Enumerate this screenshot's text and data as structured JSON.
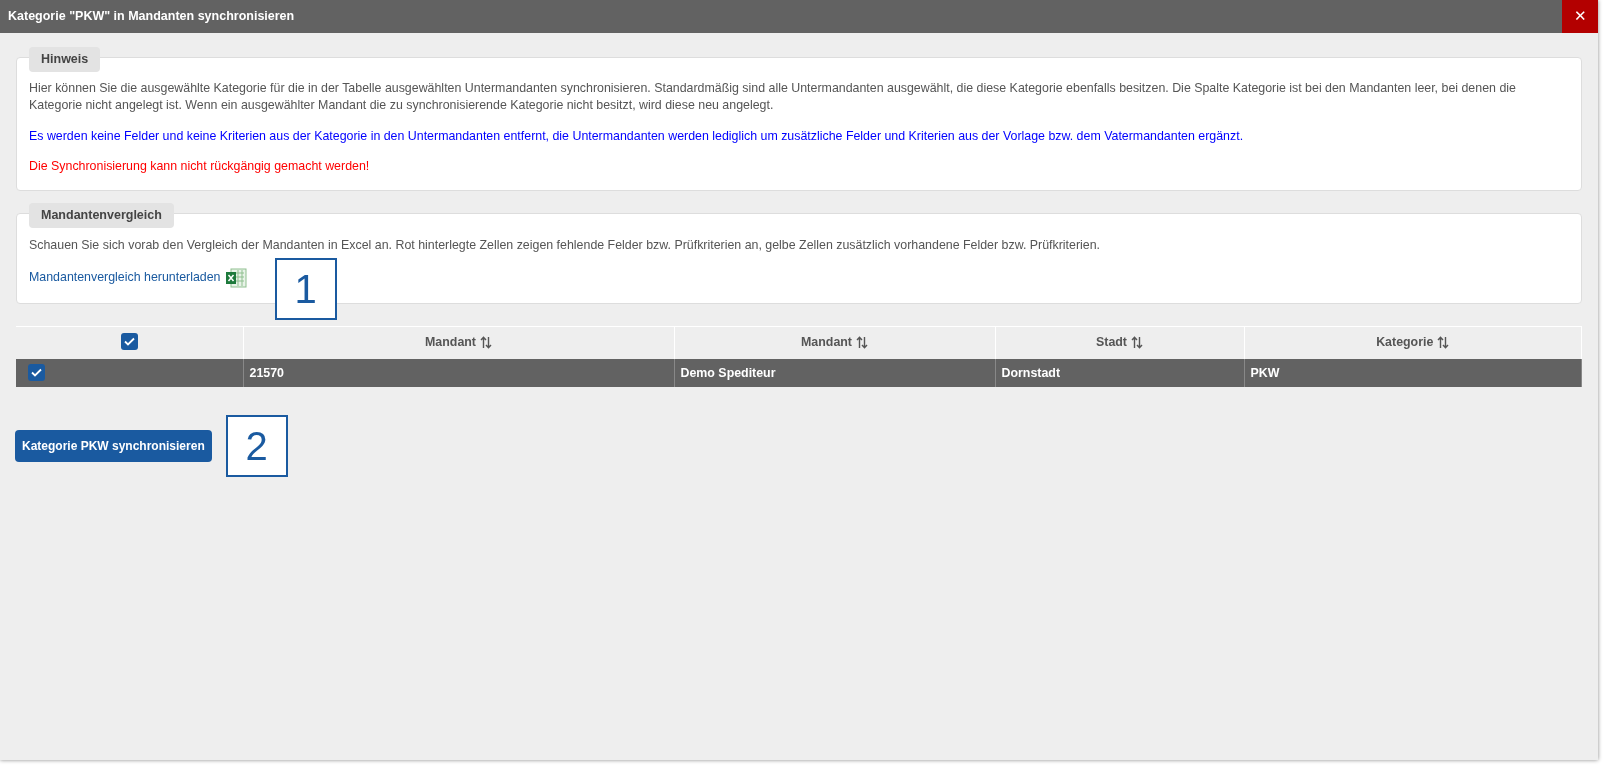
{
  "window": {
    "title": "Kategorie \"PKW\" in Mandanten synchronisieren",
    "close": "✕"
  },
  "hinweis": {
    "legend": "Hinweis",
    "paragraphs": [
      {
        "kind": "info",
        "text": "Hier können Sie die ausgewählte Kategorie für die in der Tabelle ausgewählten Untermandanten synchronisieren. Standardmäßig sind alle Untermandanten ausgewählt, die diese Kategorie ebenfalls besitzen. Die Spalte Kategorie ist bei den Mandanten leer, bei denen die Kategorie nicht angelegt ist. Wenn ein ausgewählter Mandant die zu synchronisierende Kategorie nicht besitzt, wird diese neu angelegt."
      },
      {
        "kind": "note",
        "text": "Es werden keine Felder und keine Kriterien aus der Kategorie in den Untermandanten entfernt, die Untermandanten werden lediglich um zusätzliche Felder und Kriterien aus der Vorlage bzw. dem Vatermandanten ergänzt."
      },
      {
        "kind": "warning",
        "text": "Die Synchronisierung kann nicht rückgängig gemacht werden!"
      }
    ]
  },
  "vergleich": {
    "legend": "Mandantenvergleich",
    "text": "Schauen Sie sich vorab den Vergleich der Mandanten in Excel an. Rot hinterlegte Zellen zeigen fehlende Felder bzw. Prüfkriterien an, gelbe Zellen zusätzlich vorhandene Felder bzw. Prüfkriterien.",
    "link": "Mandantenvergleich herunterladen",
    "callout": "1"
  },
  "table": {
    "select_all": {
      "checked": true
    },
    "columns": [
      "Mandant",
      "Mandant",
      "Stadt",
      "Kategorie"
    ],
    "rows": [
      {
        "checked": true,
        "selected": true,
        "cells": [
          "21570",
          "Demo Spediteur",
          "Dornstadt",
          "PKW"
        ]
      }
    ]
  },
  "sync_button": {
    "label": "Kategorie PKW synchronisieren",
    "callout": "2"
  }
}
